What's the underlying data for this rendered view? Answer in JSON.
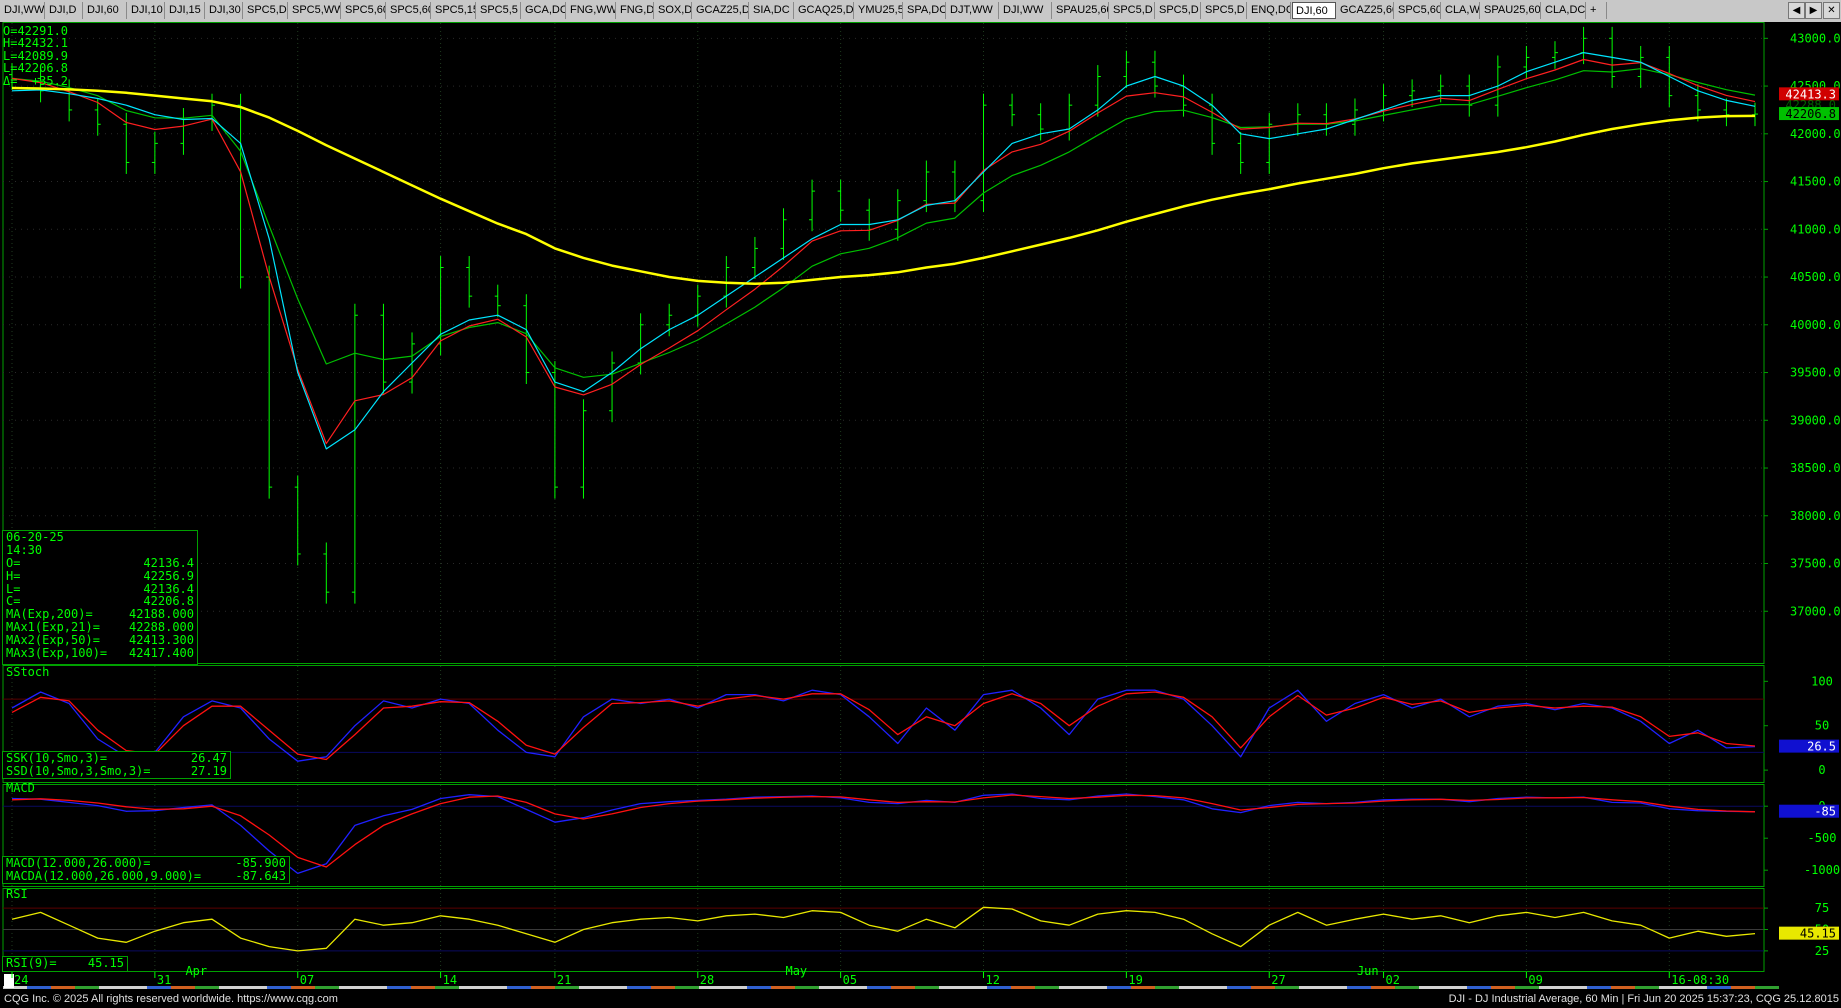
{
  "tabs": [
    "DJI,WW",
    "DJI,D",
    "DJI,60",
    "DJI,10",
    "DJI,15",
    "DJI,30",
    "SPC5,D",
    "SPC5,WW",
    "SPC5,60",
    "SPC5,60",
    "SPC5,15",
    "SPC5,5",
    "GCA,DC",
    "FNG,WW",
    "FNG,D",
    "SOX,D",
    "GCAZ25,D",
    "SIA,DC",
    "GCAQ25,D",
    "YMU25,5",
    "SPA,DC",
    "DJT,WW",
    "DJI,WW",
    "SPAU25,60",
    "SPC5,D",
    "SPC5,D",
    "SPC5,D",
    "ENQ,DC",
    "DJI,60",
    "GCAZ25,60",
    "SPC5,60",
    "CLA,W",
    "SPAU25,60",
    "CLA,DC",
    "+"
  ],
  "active_tab_index": 28,
  "nav": {
    "left_icon": "triangle-left-icon",
    "right_icon": "triangle-right-icon",
    "close_icon": "close-icon"
  },
  "ohlc_readout": [
    "O=42291.0",
    "H=42432.1",
    "L=42089.9",
    "L=42206.8",
    "Δ=  +35.2"
  ],
  "info_box": {
    "date": "06-20-25",
    "time": "14:30",
    "rows": [
      {
        "k": "O=",
        "v": "42136.4"
      },
      {
        "k": "H=",
        "v": "42256.9"
      },
      {
        "k": "L=",
        "v": "42136.4"
      },
      {
        "k": "C=",
        "v": "42206.8"
      },
      {
        "k": "MA(Exp,200)=",
        "v": "42188.000"
      },
      {
        "k": "MAx1(Exp,21)=",
        "v": "42288.000"
      },
      {
        "k": "MAx2(Exp,50)=",
        "v": "42413.300"
      },
      {
        "k": "MAx3(Exp,100)=",
        "v": "42417.400"
      }
    ]
  },
  "stoch_panel": {
    "title": "SStoch",
    "readout": [
      {
        "k": "SSK(10,Smo,3)=",
        "v": "26.47"
      },
      {
        "k": "SSD(10,Smo,3,Smo,3)=",
        "v": "27.19"
      }
    ],
    "y_ticks": [
      "100",
      "50",
      "0"
    ],
    "last_label": "26.5"
  },
  "macd_panel": {
    "title": "MACD",
    "readout": [
      {
        "k": "MACD(12.000,26.000)=",
        "v": "-85.900"
      },
      {
        "k": "MACDA(12.000,26.000,9.000)=",
        "v": "-87.643"
      }
    ],
    "y_ticks": [
      "0",
      "-500",
      "-1000"
    ],
    "last_label": "-85"
  },
  "rsi_panel": {
    "title": "RSI",
    "readout": [
      {
        "k": "RSI(9)=",
        "v": "45.15"
      }
    ],
    "y_ticks": [
      "75",
      "50",
      "25"
    ],
    "last_label": "45.15"
  },
  "price_labels": {
    "ma_last": "42413.3",
    "close_last": "42206.8",
    "hidden_label": "42288.0"
  },
  "x_axis_days": [
    "24",
    "31",
    "07",
    "14",
    "21",
    "28",
    "05",
    "12",
    "19",
    "27",
    "02",
    "09",
    "16-08:30"
  ],
  "x_axis_months": [
    "Apr",
    "May",
    "Jun"
  ],
  "status": {
    "left": "CQG Inc. © 2025 All rights reserved worldwide. https://www.cqg.com",
    "right": "DJI - DJ Industrial Average, 60 Min | Fri Jun 20 2025 15:37:23, CQG 25.12.8015"
  },
  "colors": {
    "bars": "#00ff00",
    "ma200": "#ffff00",
    "ma21": "#00e5ff",
    "ma50": "#ff2020",
    "ma100": "#00c000",
    "stoch_k": "#2020ff",
    "stoch_d": "#ff1010",
    "rsi": "#e8e800",
    "frame": "#00a000"
  },
  "chart_data": [
    {
      "type": "candlestick",
      "title": "DJI - DJ Industrial Average, 60 Min",
      "interval": "60 Min",
      "x": [
        "03-24",
        "03-25",
        "03-26",
        "03-27",
        "03-28",
        "03-31",
        "04-01",
        "04-02",
        "04-03",
        "04-04",
        "04-07",
        "04-08",
        "04-09",
        "04-10",
        "04-11",
        "04-14",
        "04-15",
        "04-16",
        "04-17",
        "04-21",
        "04-22",
        "04-23",
        "04-24",
        "04-25",
        "04-28",
        "04-29",
        "04-30",
        "05-01",
        "05-02",
        "05-05",
        "05-06",
        "05-07",
        "05-08",
        "05-09",
        "05-12",
        "05-13",
        "05-14",
        "05-15",
        "05-16",
        "05-19",
        "05-20",
        "05-21",
        "05-22",
        "05-23",
        "05-27",
        "05-28",
        "05-29",
        "05-30",
        "06-02",
        "06-03",
        "06-04",
        "06-05",
        "06-06",
        "06-09",
        "06-10",
        "06-11",
        "06-12",
        "06-13",
        "06-16",
        "06-17",
        "06-18",
        "06-20"
      ],
      "close": [
        42580,
        42450,
        42250,
        42100,
        41700,
        41900,
        42150,
        42300,
        40500,
        38300,
        37600,
        37200,
        40100,
        39400,
        39800,
        40600,
        40300,
        40200,
        39500,
        38300,
        39100,
        39600,
        40000,
        40100,
        40300,
        40600,
        40800,
        41100,
        41400,
        41200,
        41000,
        41300,
        41600,
        41300,
        42300,
        42200,
        42050,
        42300,
        42600,
        42750,
        42500,
        42300,
        41900,
        41700,
        42100,
        42200,
        42100,
        42250,
        42400,
        42450,
        42500,
        42300,
        42700,
        42800,
        42850,
        43000,
        42600,
        42800,
        42400,
        42250,
        42200,
        42206.8
      ],
      "indicators": {
        "MA(Exp,200)": [
          42480,
          42475,
          42465,
          42450,
          42430,
          42400,
          42370,
          42340,
          42280,
          42170,
          42030,
          41880,
          41740,
          41600,
          41460,
          41320,
          41190,
          41060,
          40950,
          40800,
          40700,
          40620,
          40560,
          40500,
          40460,
          40440,
          40430,
          40440,
          40470,
          40500,
          40520,
          40550,
          40600,
          40640,
          40700,
          40770,
          40840,
          40910,
          40990,
          41080,
          41160,
          41240,
          41310,
          41370,
          41420,
          41480,
          41530,
          41580,
          41640,
          41690,
          41730,
          41770,
          41810,
          41860,
          41920,
          41990,
          42050,
          42100,
          42140,
          42170,
          42185,
          42188
        ],
        "MAx1(Exp,21)": [
          42450,
          42460,
          42420,
          42370,
          42300,
          42200,
          42150,
          42160,
          41900,
          40900,
          39500,
          38700,
          38900,
          39300,
          39600,
          39900,
          40050,
          40100,
          39950,
          39400,
          39300,
          39500,
          39750,
          39950,
          40100,
          40300,
          40500,
          40700,
          40900,
          41050,
          41050,
          41100,
          41250,
          41300,
          41600,
          41900,
          42000,
          42050,
          42250,
          42500,
          42600,
          42500,
          42300,
          42000,
          41950,
          42000,
          42050,
          42150,
          42250,
          42350,
          42400,
          42400,
          42500,
          42650,
          42750,
          42850,
          42800,
          42750,
          42600,
          42450,
          42350,
          42288
        ]
      },
      "yticks": [
        37000,
        37500,
        38000,
        38500,
        39000,
        39500,
        40000,
        40500,
        41000,
        41500,
        42000,
        42500,
        43000
      ],
      "ylim": [
        36500,
        43150
      ],
      "yscale": "linear"
    },
    {
      "type": "line",
      "title": "SStoch",
      "series": [
        {
          "name": "SSK(10,Smo,3)",
          "values": [
            70,
            88,
            75,
            35,
            15,
            20,
            60,
            78,
            70,
            35,
            10,
            15,
            50,
            78,
            70,
            80,
            75,
            45,
            20,
            15,
            60,
            80,
            75,
            80,
            70,
            85,
            85,
            78,
            90,
            85,
            60,
            30,
            70,
            45,
            85,
            90,
            70,
            40,
            80,
            90,
            90,
            80,
            50,
            15,
            70,
            90,
            55,
            75,
            85,
            70,
            80,
            60,
            72,
            75,
            68,
            75,
            70,
            55,
            30,
            45,
            25,
            26.47
          ]
        },
        {
          "name": "SSD(10,Smo,3,Smo,3)",
          "values": [
            65,
            82,
            78,
            45,
            22,
            18,
            50,
            72,
            72,
            45,
            18,
            12,
            40,
            70,
            72,
            77,
            76,
            55,
            28,
            18,
            48,
            75,
            76,
            78,
            72,
            80,
            84,
            80,
            86,
            86,
            68,
            40,
            60,
            50,
            75,
            86,
            75,
            50,
            72,
            86,
            88,
            82,
            60,
            25,
            60,
            84,
            62,
            70,
            82,
            74,
            78,
            65,
            70,
            73,
            70,
            72,
            71,
            60,
            38,
            42,
            30,
            27.19
          ]
        }
      ],
      "yticks": [
        0,
        50,
        100
      ],
      "ylim": [
        -10,
        115
      ]
    },
    {
      "type": "line",
      "title": "MACD",
      "series": [
        {
          "name": "MACD(12.000,26.000)",
          "values": [
            120,
            110,
            60,
            10,
            -80,
            -70,
            -20,
            20,
            -300,
            -700,
            -1050,
            -900,
            -300,
            -150,
            -50,
            120,
            180,
            150,
            -50,
            -250,
            -180,
            -60,
            40,
            70,
            90,
            110,
            140,
            150,
            160,
            130,
            60,
            40,
            90,
            60,
            170,
            190,
            120,
            100,
            160,
            190,
            150,
            100,
            -40,
            -100,
            10,
            60,
            40,
            60,
            100,
            110,
            110,
            70,
            120,
            140,
            130,
            140,
            60,
            50,
            -40,
            -70,
            -80,
            -85.9
          ]
        },
        {
          "name": "MACDA(12.000,26.000,9.000)",
          "values": [
            100,
            115,
            90,
            50,
            -10,
            -50,
            -40,
            0,
            -150,
            -450,
            -800,
            -950,
            -600,
            -300,
            -120,
            40,
            140,
            160,
            60,
            -120,
            -200,
            -120,
            -20,
            40,
            80,
            100,
            125,
            140,
            150,
            145,
            100,
            60,
            70,
            65,
            130,
            175,
            150,
            120,
            140,
            170,
            165,
            130,
            40,
            -60,
            -20,
            30,
            40,
            50,
            80,
            100,
            108,
            90,
            105,
            130,
            132,
            136,
            100,
            70,
            0,
            -50,
            -75,
            -87.643
          ]
        }
      ],
      "yticks": [
        -1000,
        -500,
        0
      ],
      "ylim": [
        -1200,
        300
      ]
    },
    {
      "type": "line",
      "title": "RSI",
      "series": [
        {
          "name": "RSI(9)",
          "values": [
            62,
            70,
            55,
            40,
            35,
            48,
            58,
            62,
            40,
            30,
            25,
            28,
            62,
            55,
            58,
            66,
            62,
            55,
            45,
            35,
            50,
            58,
            62,
            64,
            60,
            66,
            68,
            64,
            72,
            70,
            55,
            48,
            62,
            52,
            76,
            74,
            60,
            55,
            68,
            72,
            70,
            62,
            45,
            30,
            55,
            70,
            55,
            62,
            68,
            62,
            66,
            58,
            66,
            70,
            64,
            70,
            60,
            55,
            40,
            48,
            42,
            45.15
          ]
        }
      ],
      "yticks": [
        25,
        50,
        75
      ],
      "ylim": [
        5,
        95
      ]
    }
  ]
}
